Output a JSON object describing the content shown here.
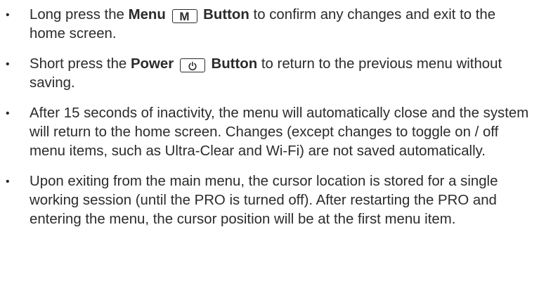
{
  "bullets": [
    {
      "before": "Long press the ",
      "bold1": "Menu",
      "key_glyph": "M",
      "bold2": "Button",
      "after": " to confirm any changes and exit to the home screen."
    },
    {
      "before": "Short press the ",
      "bold1": "Power",
      "key_icon": "power-icon",
      "bold2": "Button",
      "after": " to return to the previous menu without saving."
    },
    {
      "text": "After 15 seconds of inactivity, the menu will automatically close and the system will return to the home screen. Changes (except changes to toggle on / off menu items, such as Ultra-Clear and Wi-Fi) are not saved automatically."
    },
    {
      "text": "Upon exiting from the main menu, the cursor location is stored for a single working session (until the PRO is turned off). After restarting the PRO and entering the menu, the cursor position will be at the first menu item."
    }
  ],
  "bullet_symbol": "•"
}
